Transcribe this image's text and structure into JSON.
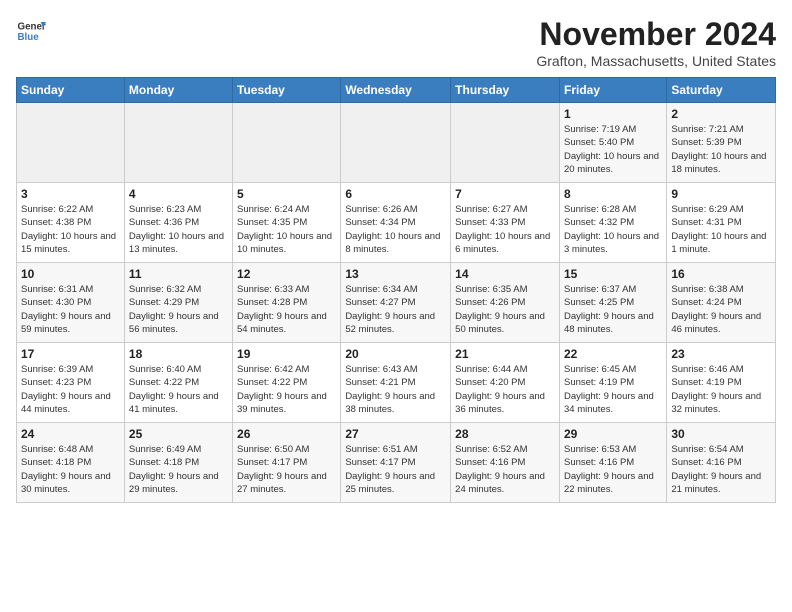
{
  "header": {
    "logo_line1": "General",
    "logo_line2": "Blue",
    "month_title": "November 2024",
    "location": "Grafton, Massachusetts, United States"
  },
  "weekdays": [
    "Sunday",
    "Monday",
    "Tuesday",
    "Wednesday",
    "Thursday",
    "Friday",
    "Saturday"
  ],
  "weeks": [
    [
      {
        "day": "",
        "info": ""
      },
      {
        "day": "",
        "info": ""
      },
      {
        "day": "",
        "info": ""
      },
      {
        "day": "",
        "info": ""
      },
      {
        "day": "",
        "info": ""
      },
      {
        "day": "1",
        "info": "Sunrise: 7:19 AM\nSunset: 5:40 PM\nDaylight: 10 hours and 20 minutes."
      },
      {
        "day": "2",
        "info": "Sunrise: 7:21 AM\nSunset: 5:39 PM\nDaylight: 10 hours and 18 minutes."
      }
    ],
    [
      {
        "day": "3",
        "info": "Sunrise: 6:22 AM\nSunset: 4:38 PM\nDaylight: 10 hours and 15 minutes."
      },
      {
        "day": "4",
        "info": "Sunrise: 6:23 AM\nSunset: 4:36 PM\nDaylight: 10 hours and 13 minutes."
      },
      {
        "day": "5",
        "info": "Sunrise: 6:24 AM\nSunset: 4:35 PM\nDaylight: 10 hours and 10 minutes."
      },
      {
        "day": "6",
        "info": "Sunrise: 6:26 AM\nSunset: 4:34 PM\nDaylight: 10 hours and 8 minutes."
      },
      {
        "day": "7",
        "info": "Sunrise: 6:27 AM\nSunset: 4:33 PM\nDaylight: 10 hours and 6 minutes."
      },
      {
        "day": "8",
        "info": "Sunrise: 6:28 AM\nSunset: 4:32 PM\nDaylight: 10 hours and 3 minutes."
      },
      {
        "day": "9",
        "info": "Sunrise: 6:29 AM\nSunset: 4:31 PM\nDaylight: 10 hours and 1 minute."
      }
    ],
    [
      {
        "day": "10",
        "info": "Sunrise: 6:31 AM\nSunset: 4:30 PM\nDaylight: 9 hours and 59 minutes."
      },
      {
        "day": "11",
        "info": "Sunrise: 6:32 AM\nSunset: 4:29 PM\nDaylight: 9 hours and 56 minutes."
      },
      {
        "day": "12",
        "info": "Sunrise: 6:33 AM\nSunset: 4:28 PM\nDaylight: 9 hours and 54 minutes."
      },
      {
        "day": "13",
        "info": "Sunrise: 6:34 AM\nSunset: 4:27 PM\nDaylight: 9 hours and 52 minutes."
      },
      {
        "day": "14",
        "info": "Sunrise: 6:35 AM\nSunset: 4:26 PM\nDaylight: 9 hours and 50 minutes."
      },
      {
        "day": "15",
        "info": "Sunrise: 6:37 AM\nSunset: 4:25 PM\nDaylight: 9 hours and 48 minutes."
      },
      {
        "day": "16",
        "info": "Sunrise: 6:38 AM\nSunset: 4:24 PM\nDaylight: 9 hours and 46 minutes."
      }
    ],
    [
      {
        "day": "17",
        "info": "Sunrise: 6:39 AM\nSunset: 4:23 PM\nDaylight: 9 hours and 44 minutes."
      },
      {
        "day": "18",
        "info": "Sunrise: 6:40 AM\nSunset: 4:22 PM\nDaylight: 9 hours and 41 minutes."
      },
      {
        "day": "19",
        "info": "Sunrise: 6:42 AM\nSunset: 4:22 PM\nDaylight: 9 hours and 39 minutes."
      },
      {
        "day": "20",
        "info": "Sunrise: 6:43 AM\nSunset: 4:21 PM\nDaylight: 9 hours and 38 minutes."
      },
      {
        "day": "21",
        "info": "Sunrise: 6:44 AM\nSunset: 4:20 PM\nDaylight: 9 hours and 36 minutes."
      },
      {
        "day": "22",
        "info": "Sunrise: 6:45 AM\nSunset: 4:19 PM\nDaylight: 9 hours and 34 minutes."
      },
      {
        "day": "23",
        "info": "Sunrise: 6:46 AM\nSunset: 4:19 PM\nDaylight: 9 hours and 32 minutes."
      }
    ],
    [
      {
        "day": "24",
        "info": "Sunrise: 6:48 AM\nSunset: 4:18 PM\nDaylight: 9 hours and 30 minutes."
      },
      {
        "day": "25",
        "info": "Sunrise: 6:49 AM\nSunset: 4:18 PM\nDaylight: 9 hours and 29 minutes."
      },
      {
        "day": "26",
        "info": "Sunrise: 6:50 AM\nSunset: 4:17 PM\nDaylight: 9 hours and 27 minutes."
      },
      {
        "day": "27",
        "info": "Sunrise: 6:51 AM\nSunset: 4:17 PM\nDaylight: 9 hours and 25 minutes."
      },
      {
        "day": "28",
        "info": "Sunrise: 6:52 AM\nSunset: 4:16 PM\nDaylight: 9 hours and 24 minutes."
      },
      {
        "day": "29",
        "info": "Sunrise: 6:53 AM\nSunset: 4:16 PM\nDaylight: 9 hours and 22 minutes."
      },
      {
        "day": "30",
        "info": "Sunrise: 6:54 AM\nSunset: 4:16 PM\nDaylight: 9 hours and 21 minutes."
      }
    ]
  ]
}
